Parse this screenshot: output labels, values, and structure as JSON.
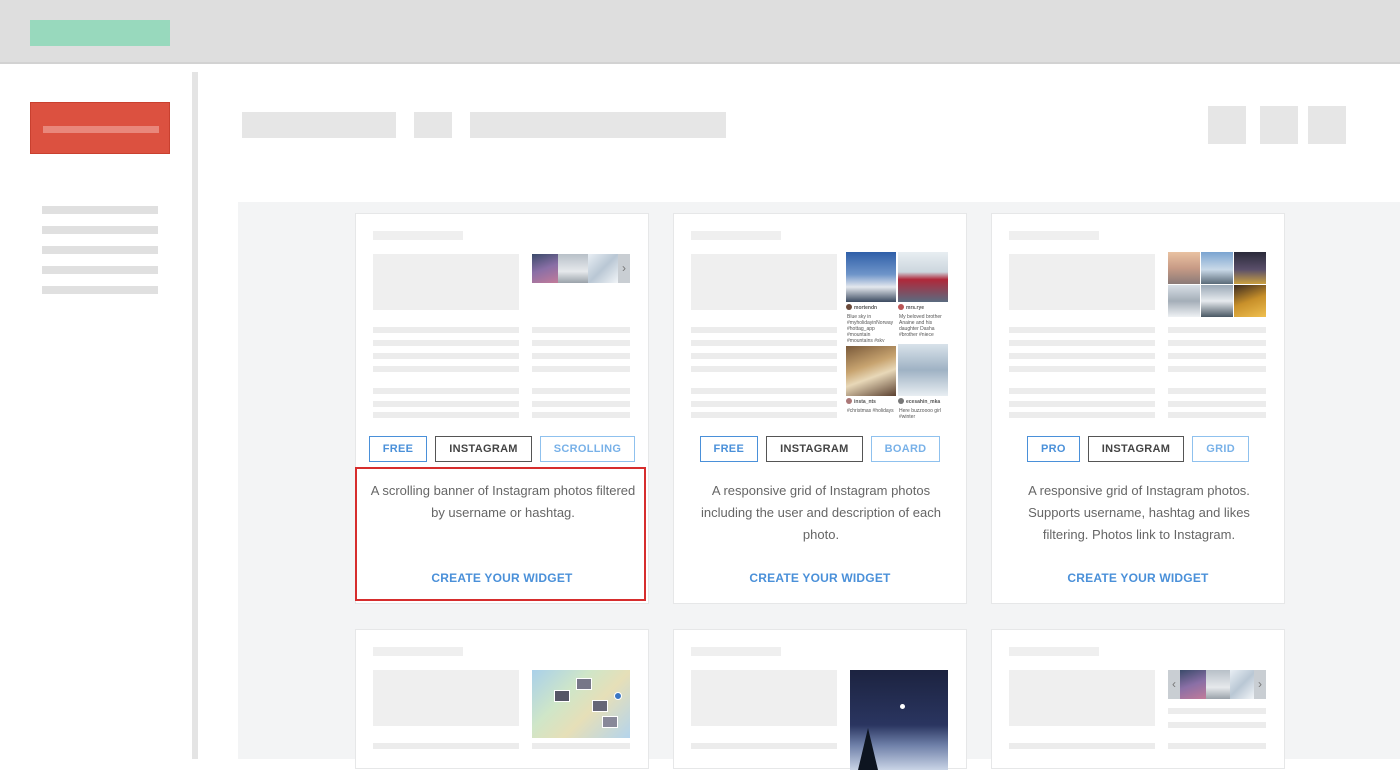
{
  "cards": [
    {
      "tags": [
        "FREE",
        "INSTAGRAM",
        "SCROLLING"
      ],
      "description": "A scrolling banner of Instagram photos filtered by username or hashtag.",
      "cta": "CREATE YOUR WIDGET"
    },
    {
      "tags": [
        "FREE",
        "INSTAGRAM",
        "BOARD"
      ],
      "description": "A responsive grid of Instagram photos including the user and description of each photo.",
      "cta": "CREATE YOUR WIDGET",
      "preview": {
        "users": [
          "mortendn",
          "mrs.rye",
          "insta_nts",
          "ecesahin_mka"
        ],
        "captions": [
          "Blue sky in #myholidayinNorway #hottag_app #mountain #mountains #sky #beautiful",
          "My beloved brother Anaine and his daughter Dasha #brother #niece",
          "#christmas #holidays",
          "Here buzzoooo girl #winter"
        ]
      }
    },
    {
      "tags": [
        "PRO",
        "INSTAGRAM",
        "GRID"
      ],
      "description": "A responsive grid of Instagram photos. Supports username, hashtag and likes filtering. Photos link to Instagram.",
      "cta": "CREATE YOUR WIDGET"
    }
  ],
  "colors": {
    "accent": "#4a90d9",
    "highlight": "#d62d2d",
    "logo": "#98d9bd",
    "primary_button": "#dc5140"
  },
  "icons": [
    "chevron-right-icon",
    "chevron-left-icon",
    "map-pin-icon"
  ]
}
